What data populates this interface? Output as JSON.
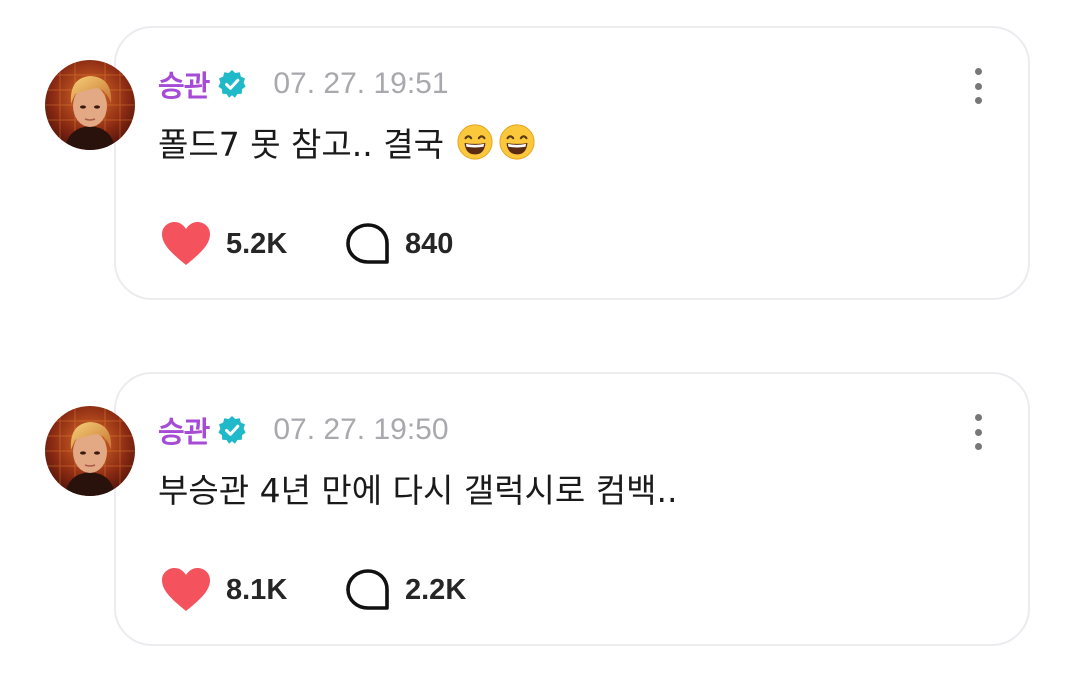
{
  "posts": [
    {
      "author": "승관",
      "timestamp": "07. 27. 19:51",
      "text": "폴드7 못 참고.. 결국",
      "emoji": [
        "grinning-face-with-smiling-eyes",
        "grinning-face-with-smiling-eyes"
      ],
      "likes": "5.2K",
      "comments": "840"
    },
    {
      "author": "승관",
      "timestamp": "07. 27. 19:50",
      "text": "부승관 4년 만에 다시 갤럭시로 컴백..",
      "emoji": [],
      "likes": "8.1K",
      "comments": "2.2K"
    }
  ],
  "colors": {
    "author": "#a64bd6",
    "verified_badge": "#20b9c9",
    "heart": "#f4525c",
    "timestamp": "#a8a8ad",
    "card_border": "#ececf0"
  },
  "icons": {
    "verified": "verified-badge-icon",
    "like": "heart-icon",
    "comment": "comment-bubble-icon",
    "more": "kebab-menu-icon"
  }
}
